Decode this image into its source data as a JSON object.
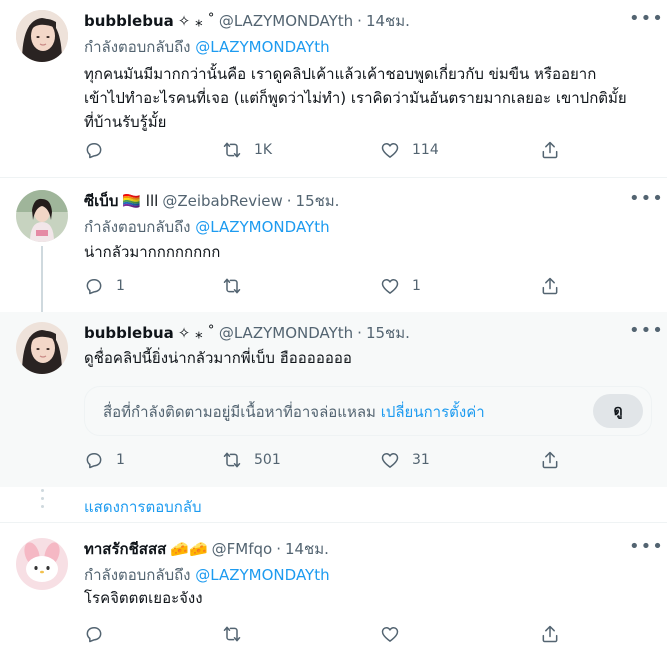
{
  "tweets": [
    {
      "name": "bubblebua",
      "name_extra": "✧ ⁎ ˚",
      "handle": "@LAZYMONDAYth",
      "time": "14ชม.",
      "reply_prefix": "กำลังตอบกลับถึง",
      "reply_mention": "@LAZYMONDAYth",
      "text_lines": [
        "ทุกคนมันมีมากกว่านั้นคือ เราดูคลิปเค้าแล้วเค้าชอบพูดเกี่ยวกับ ข่มขืน หรืออยาก",
        "เข้าไปทำอะไรคนที่เจอ (แต่ก็พูดว่าไม่ทำ) เราคิดว่ามันอันตรายมากเลยอะ เขาปกติมั้ย",
        "ที่บ้านรับรู้มั้ย"
      ],
      "replies": "",
      "retweets": "1K",
      "likes": "114"
    },
    {
      "name": "ซีเบ็บ",
      "name_extra": "🏳️‍🌈 lll",
      "handle": "@ZeibabReview",
      "time": "15ชม.",
      "reply_prefix": "กำลังตอบกลับถึง",
      "reply_mention": "@LAZYMONDAYth",
      "text_lines": [
        "น่ากลัวมากกกกกกกก"
      ],
      "replies": "1",
      "retweets": "",
      "likes": "1"
    },
    {
      "name": "bubblebua",
      "name_extra": "✧ ⁎ ˚",
      "handle": "@LAZYMONDAYth",
      "time": "15ชม.",
      "text_lines": [
        "ดูชื่อคลิปนี้ยิ่งน่ากลัวมากพี่เบ็บ ฮือออออออ"
      ],
      "warning": {
        "text": "สื่อที่กำลังติดตามอยู่มีเนื้อหาที่อาจล่อแหลม",
        "link": "เปลี่ยนการตั้งค่า",
        "button": "ดู"
      },
      "replies": "1",
      "retweets": "501",
      "likes": "31"
    },
    {
      "name": "ทาสรักชีสสส",
      "name_extra": "🧀🧀",
      "handle": "@FMfqo",
      "time": "14ชม.",
      "reply_prefix": "กำลังตอบกลับถึง",
      "reply_mention": "@LAZYMONDAYth",
      "text_lines": [
        "โรคจิตตตเยอะจังง"
      ],
      "replies": "",
      "retweets": "",
      "likes": ""
    }
  ],
  "show_replies": "แสดงการตอบกลับ",
  "icons": {
    "reply": "reply-icon",
    "retweet": "retweet-icon",
    "like": "heart-icon",
    "share": "share-icon",
    "more": "more-icon"
  },
  "colors": {
    "accent": "#1d9bf0",
    "secondary_text": "#536471",
    "primary_text": "#0f1419",
    "highlight_bg": "#f7f9f9"
  }
}
